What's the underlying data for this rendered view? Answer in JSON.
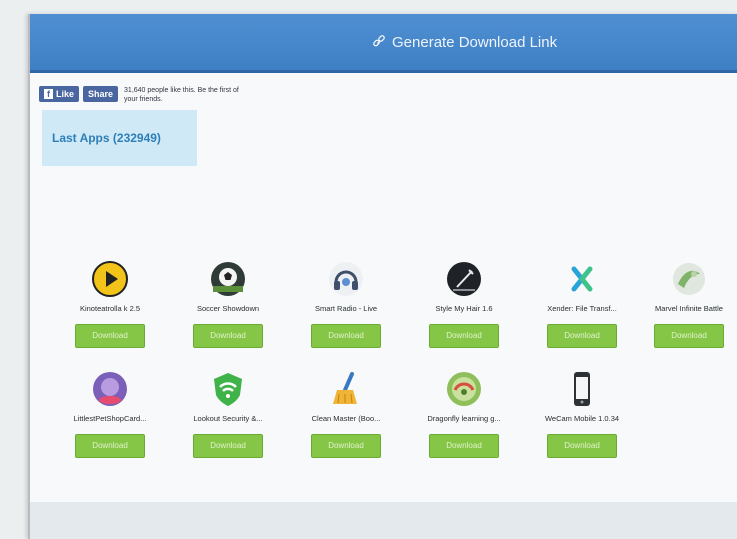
{
  "header": {
    "generate_link_label": "Generate Download Link"
  },
  "social": {
    "like_label": "Like",
    "share_label": "Share",
    "likes_text": "31,640 people like this. Be the first of your friends."
  },
  "section": {
    "title": "Last Apps (232949)"
  },
  "download_label": "Download",
  "apps": [
    {
      "name": "Kinoteatrolla k 2.5",
      "icon": "play-icon"
    },
    {
      "name": "Soccer Showdown",
      "icon": "soccer-ball-icon"
    },
    {
      "name": "Smart Radio - Live",
      "icon": "radio-headphones-icon"
    },
    {
      "name": "Style My Hair 1.6",
      "icon": "hair-style-icon"
    },
    {
      "name": "Xender: File Transf...",
      "icon": "xender-icon"
    },
    {
      "name": "Marvel Infinite Battle",
      "icon": "marvel-icon"
    },
    {
      "name": "LittlestPetShopCard...",
      "icon": "pet-shop-icon"
    },
    {
      "name": "Lookout Security &...",
      "icon": "wifi-shield-icon"
    },
    {
      "name": "Clean Master (Boo...",
      "icon": "broom-icon"
    },
    {
      "name": "Dragonfly learning g...",
      "icon": "dragonfly-icon"
    },
    {
      "name": "WeCam Mobile 1.0.34",
      "icon": "phone-icon"
    }
  ],
  "colors": {
    "header_blue": "#4f8fd2",
    "download_green": "#86c646",
    "section_bg": "#cfe9f6",
    "section_text": "#2e7fb8"
  }
}
